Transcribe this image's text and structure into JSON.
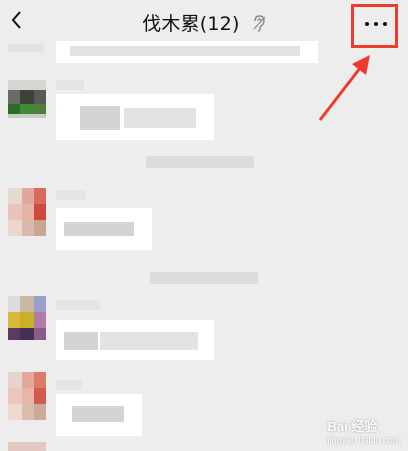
{
  "header": {
    "title": "伐木累(12)",
    "back_icon": "chevron-left-icon",
    "mute_icon": "ear-mute-icon",
    "more_icon": "more-dots-icon"
  },
  "annotation": {
    "highlight_color": "#f03a2e"
  },
  "colors": {
    "background": "#ededed",
    "bubble": "#ffffff"
  },
  "watermark": {
    "brand": "Bai 经验",
    "url": "jingyan.baidu.com"
  }
}
